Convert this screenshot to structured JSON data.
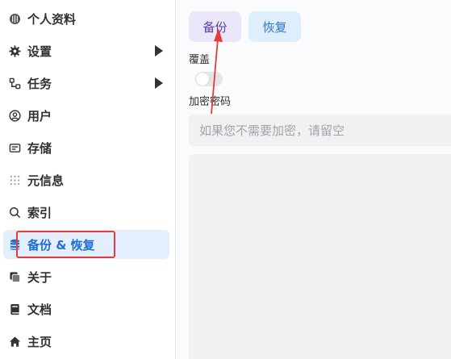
{
  "sidebar": {
    "items": [
      {
        "id": "profile",
        "label": "个人资料",
        "icon": "profile-icon"
      },
      {
        "id": "settings",
        "label": "设置",
        "icon": "gear-icon",
        "expandable": true
      },
      {
        "id": "tasks",
        "label": "任务",
        "icon": "workflow-icon",
        "expandable": true
      },
      {
        "id": "users",
        "label": "用户",
        "icon": "user-icon"
      },
      {
        "id": "storage",
        "label": "存储",
        "icon": "storage-icon"
      },
      {
        "id": "metadata",
        "label": "元信息",
        "icon": "metadata-icon"
      },
      {
        "id": "index",
        "label": "索引",
        "icon": "search-icon"
      },
      {
        "id": "backup",
        "label": "备份 & 恢复",
        "icon": "database-icon",
        "active": true
      },
      {
        "id": "about",
        "label": "关于",
        "icon": "copy-icon"
      },
      {
        "id": "docs",
        "label": "文档",
        "icon": "book-icon"
      },
      {
        "id": "home",
        "label": "主页",
        "icon": "home-icon"
      }
    ]
  },
  "main": {
    "backup_label": "备份",
    "restore_label": "恢复",
    "overwrite_label": "覆盖",
    "overwrite_on": false,
    "password_label": "加密密码",
    "password_placeholder": "如果您不需要加密，请留空",
    "password_value": ""
  },
  "colors": {
    "active_bg": "#e3effd",
    "active_text": "#1f6fd1",
    "backup_btn_bg": "#ece6fb",
    "restore_btn_bg": "#dfeefd",
    "annotation": "#e43b3b"
  }
}
